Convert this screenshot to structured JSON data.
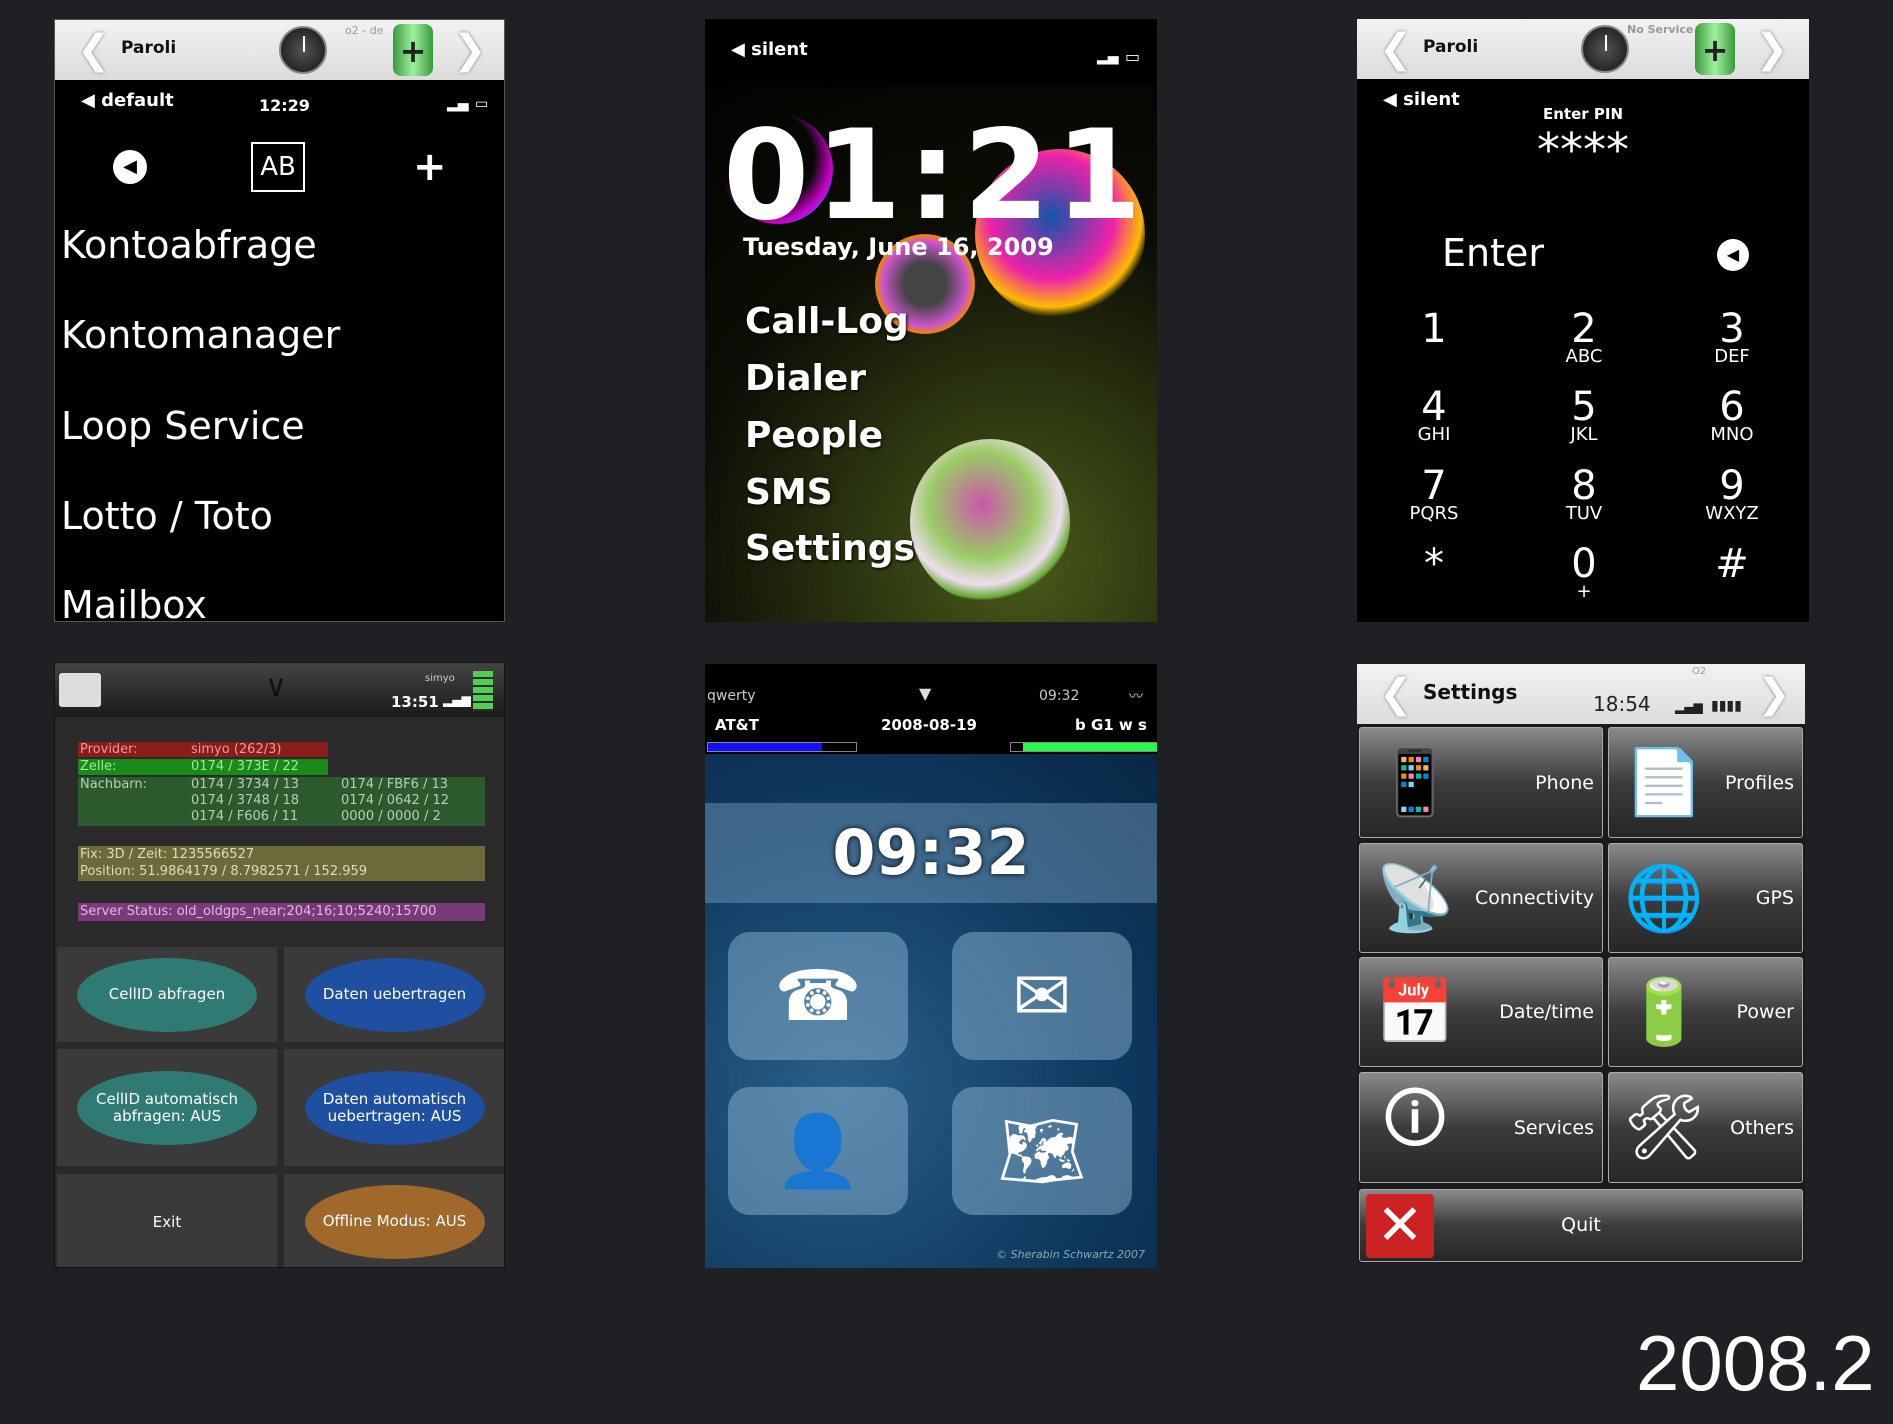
{
  "panel1": {
    "title": "Paroli",
    "operator": "o2 - de",
    "profile": "default",
    "time": "12:29",
    "menu": [
      "Kontoabfrage",
      "Kontomanager",
      "Loop Service",
      "Lotto / Toto",
      "Mailbox"
    ]
  },
  "panel2": {
    "profile": "silent",
    "time": "01:21",
    "date": "Tuesday, June 16, 2009",
    "menu": [
      "Call-Log",
      "Dialer",
      "People",
      "SMS",
      "Settings"
    ]
  },
  "panel3": {
    "title": "Paroli",
    "operator": "No Service",
    "profile": "silent",
    "prompt": "Enter PIN",
    "pin": "****",
    "enter": "Enter",
    "keys": [
      {
        "d": "1",
        "l": ""
      },
      {
        "d": "2",
        "l": "ABC"
      },
      {
        "d": "3",
        "l": "DEF"
      },
      {
        "d": "4",
        "l": "GHI"
      },
      {
        "d": "5",
        "l": "JKL"
      },
      {
        "d": "6",
        "l": "MNO"
      },
      {
        "d": "7",
        "l": "PQRS"
      },
      {
        "d": "8",
        "l": "TUV"
      },
      {
        "d": "9",
        "l": "WXYZ"
      },
      {
        "d": "*",
        "l": ""
      },
      {
        "d": "0",
        "l": "+"
      },
      {
        "d": "#",
        "l": ""
      }
    ]
  },
  "panel4": {
    "operator": "simyo",
    "time": "13:51",
    "provider_label": "Provider:",
    "provider_value": "simyo (262/3)",
    "cell_label": "Zelle:",
    "cell_value": "0174 / 373E / 22",
    "neighbors_label": "Nachbarn:",
    "neighbors": [
      "0174 / 3734 / 13",
      "0174 / FBF6 / 13",
      "0174 / 3748 / 18",
      "0174 / 0642 / 12",
      "0174 / F606 / 11",
      "0000 / 0000 / 2"
    ],
    "fix": "Fix: 3D / Zeit: 1235566527",
    "position": "Position: 51.9864179 / 8.7982571 / 152.959",
    "server": "Server Status: old_oldgps_near;204;16;10;5240;15700",
    "buttons": [
      "CellID abfragen",
      "Daten uebertragen",
      "CellID automatisch abfragen: AUS",
      "Daten automatisch uebertragen: AUS",
      "Exit",
      "Offline Modus: AUS"
    ]
  },
  "panel5": {
    "keyboard": "qwerty",
    "status_time": "09:32",
    "carrier": "AT&T",
    "date": "2008-08-19",
    "flags": "b G1 w s",
    "left_bar": 0.77,
    "right_bar": 0.92,
    "clock": "09:32",
    "credit": "© Sherabin Schwartz 2007"
  },
  "panel6": {
    "title": "Settings",
    "operator": "O2",
    "time": "18:54",
    "items": [
      "Phone",
      "Profiles",
      "Connectivity",
      "GPS",
      "Date/time",
      "Power",
      "Services",
      "Others"
    ],
    "quit": "Quit"
  },
  "version": "2008.2"
}
